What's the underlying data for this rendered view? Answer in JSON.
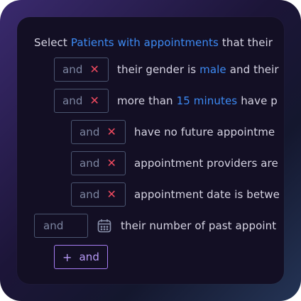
{
  "header": {
    "prefix": "Select",
    "entity": "Patients with appointments",
    "suffix": "that their"
  },
  "rows": [
    {
      "connector": "and",
      "remove_glyph": "✕",
      "segments": [
        "their gender is",
        "male",
        "and their"
      ]
    },
    {
      "connector": "and",
      "remove_glyph": "✕",
      "segments": [
        "more than",
        "15 minutes",
        "have p"
      ]
    },
    {
      "connector": "and",
      "remove_glyph": "✕",
      "text": "have no future appointme"
    },
    {
      "connector": "and",
      "remove_glyph": "✕",
      "text": "appointment providers are"
    },
    {
      "connector": "and",
      "remove_glyph": "✕",
      "text": "appointment date is betwe"
    },
    {
      "connector_placeholder": "and",
      "icon": "calendar-icon",
      "text": "their number of past appoint"
    }
  ],
  "add_button": {
    "plus": "+",
    "label": "and"
  },
  "colors": {
    "highlight": "#3d8bf5",
    "remove": "#ef4a5f",
    "add_accent": "#a77ef5",
    "pill_border": "#4b5671",
    "text": "#d6d4e3",
    "panel": "#130f24"
  }
}
